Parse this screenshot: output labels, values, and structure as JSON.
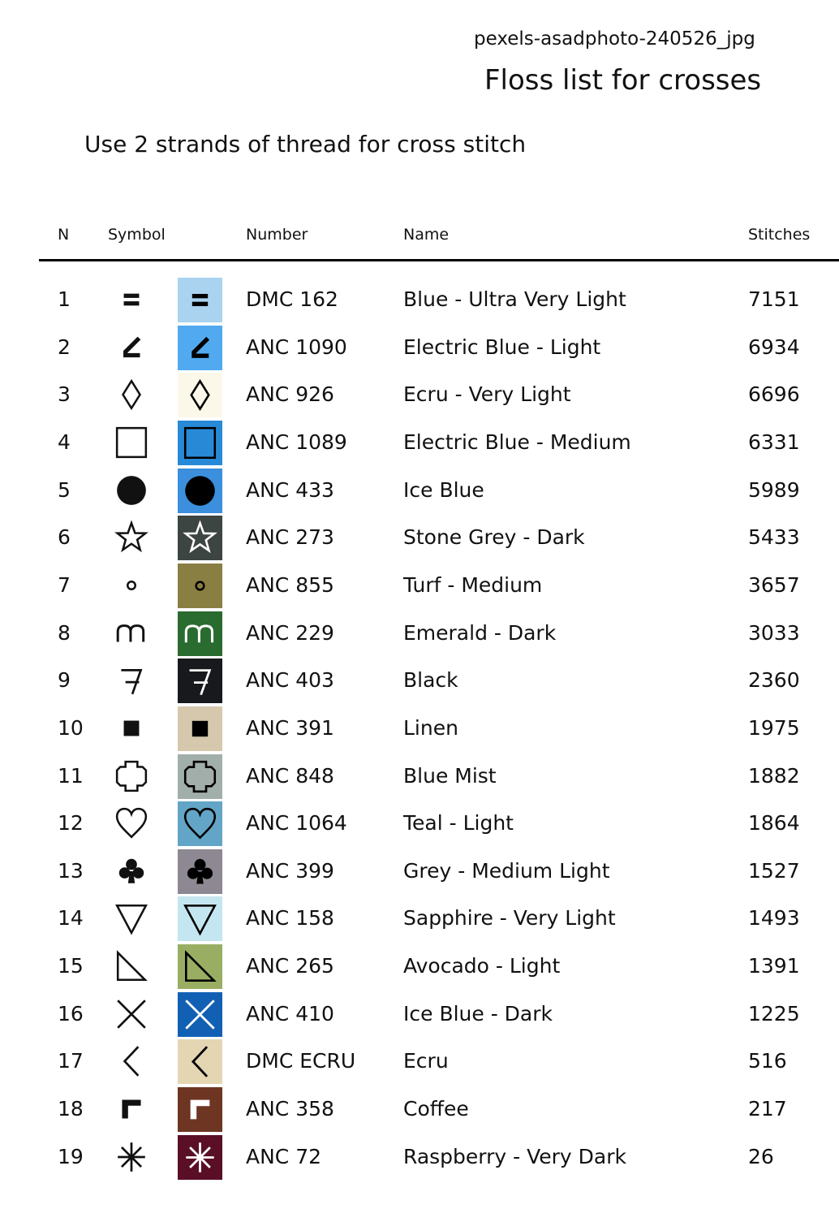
{
  "header": {
    "filename": "pexels-asadphoto-240526_jpg",
    "title": "Floss list for crosses",
    "note": "Use 2 strands of thread for cross stitch"
  },
  "table": {
    "columns": {
      "n": "N",
      "symbol": "Symbol",
      "number": "Number",
      "name": "Name",
      "stitches": "Stitches"
    },
    "rows": [
      {
        "n": "1",
        "symbol": "double-bar-icon",
        "number": "DMC 162",
        "name": "Blue - Ultra Very Light",
        "stitches": "7151",
        "color": "#a9d3ef"
      },
      {
        "n": "2",
        "symbol": "angle-mark-icon",
        "number": "ANC 1090",
        "name": "Electric Blue - Light",
        "stitches": "6934",
        "color": "#51aaf0"
      },
      {
        "n": "3",
        "symbol": "diamond-outline-icon",
        "number": "ANC 926",
        "name": "Ecru - Very Light",
        "stitches": "6696",
        "color": "#fbf8ea"
      },
      {
        "n": "4",
        "symbol": "square-outline-icon",
        "number": "ANC 1089",
        "name": "Electric Blue - Medium",
        "stitches": "6331",
        "color": "#288ad7"
      },
      {
        "n": "5",
        "symbol": "filled-circle-icon",
        "number": "ANC 433",
        "name": "Ice Blue",
        "stitches": "5989",
        "color": "#3b8fdd"
      },
      {
        "n": "6",
        "symbol": "star-outline-icon",
        "number": "ANC 273",
        "name": "Stone Grey - Dark",
        "stitches": "5433",
        "color": "#3d4542"
      },
      {
        "n": "7",
        "symbol": "small-ring-icon",
        "number": "ANC 855",
        "name": "Turf - Medium",
        "stitches": "3657",
        "color": "#8a7f43"
      },
      {
        "n": "8",
        "symbol": "letter-m-icon",
        "number": "ANC 229",
        "name": "Emerald - Dark",
        "stitches": "3033",
        "color": "#2a6b2f"
      },
      {
        "n": "9",
        "symbol": "seven-glyph-icon",
        "number": "ANC 403",
        "name": "Black",
        "stitches": "2360",
        "color": "#17191c"
      },
      {
        "n": "10",
        "symbol": "filled-square-icon",
        "number": "ANC 391",
        "name": "Linen",
        "stitches": "1975",
        "color": "#d5c8ac"
      },
      {
        "n": "11",
        "symbol": "cross-outline-icon",
        "number": "ANC 848",
        "name": "Blue Mist",
        "stitches": "1882",
        "color": "#a2aeaa"
      },
      {
        "n": "12",
        "symbol": "heart-outline-icon",
        "number": "ANC 1064",
        "name": "Teal - Light",
        "stitches": "1864",
        "color": "#62a5c6"
      },
      {
        "n": "13",
        "symbol": "club-icon",
        "number": "ANC 399",
        "name": "Grey - Medium Light",
        "stitches": "1527",
        "color": "#8d8891"
      },
      {
        "n": "14",
        "symbol": "triangle-down-icon",
        "number": "ANC 158",
        "name": "Sapphire - Very Light",
        "stitches": "1493",
        "color": "#c4e6f0"
      },
      {
        "n": "15",
        "symbol": "right-triangle-icon",
        "number": "ANC 265",
        "name": "Avocado - Light",
        "stitches": "1391",
        "color": "#99ae63"
      },
      {
        "n": "16",
        "symbol": "x-mark-icon",
        "number": "ANC 410",
        "name": "Ice Blue - Dark",
        "stitches": "1225",
        "color": "#1260b4"
      },
      {
        "n": "17",
        "symbol": "chevron-left-icon",
        "number": "DMC ECRU",
        "name": "Ecru",
        "stitches": "516",
        "color": "#e4d5b3"
      },
      {
        "n": "18",
        "symbol": "corner-bracket-icon",
        "number": "ANC 358",
        "name": "Coffee",
        "stitches": "217",
        "color": "#6d3522"
      },
      {
        "n": "19",
        "symbol": "asterisk-icon",
        "number": "ANC 72",
        "name": "Raspberry - Very Dark",
        "stitches": "26",
        "color": "#5a0f27"
      }
    ]
  }
}
